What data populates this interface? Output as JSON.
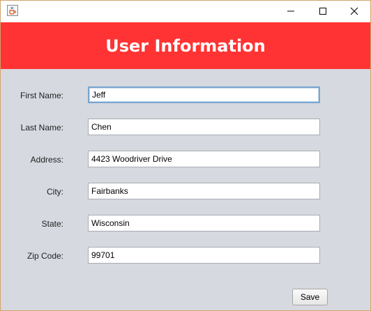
{
  "window": {
    "icon": "java-cup-icon",
    "controls": [
      "minimize-icon",
      "maximize-icon",
      "close-icon"
    ]
  },
  "header": {
    "title": "User Information",
    "background_color": "#ff3333",
    "text_color": "#ffffff"
  },
  "form": {
    "fields": [
      {
        "label": "First Name:",
        "value": "Jeff",
        "focused": true
      },
      {
        "label": "Last Name:",
        "value": "Chen"
      },
      {
        "label": "Address:",
        "value": "4423 Woodriver Drive"
      },
      {
        "label": "City:",
        "value": "Fairbanks"
      },
      {
        "label": "State:",
        "value": "Wisconsin"
      },
      {
        "label": "Zip Code:",
        "value": "99701"
      }
    ],
    "save_label": "Save"
  }
}
